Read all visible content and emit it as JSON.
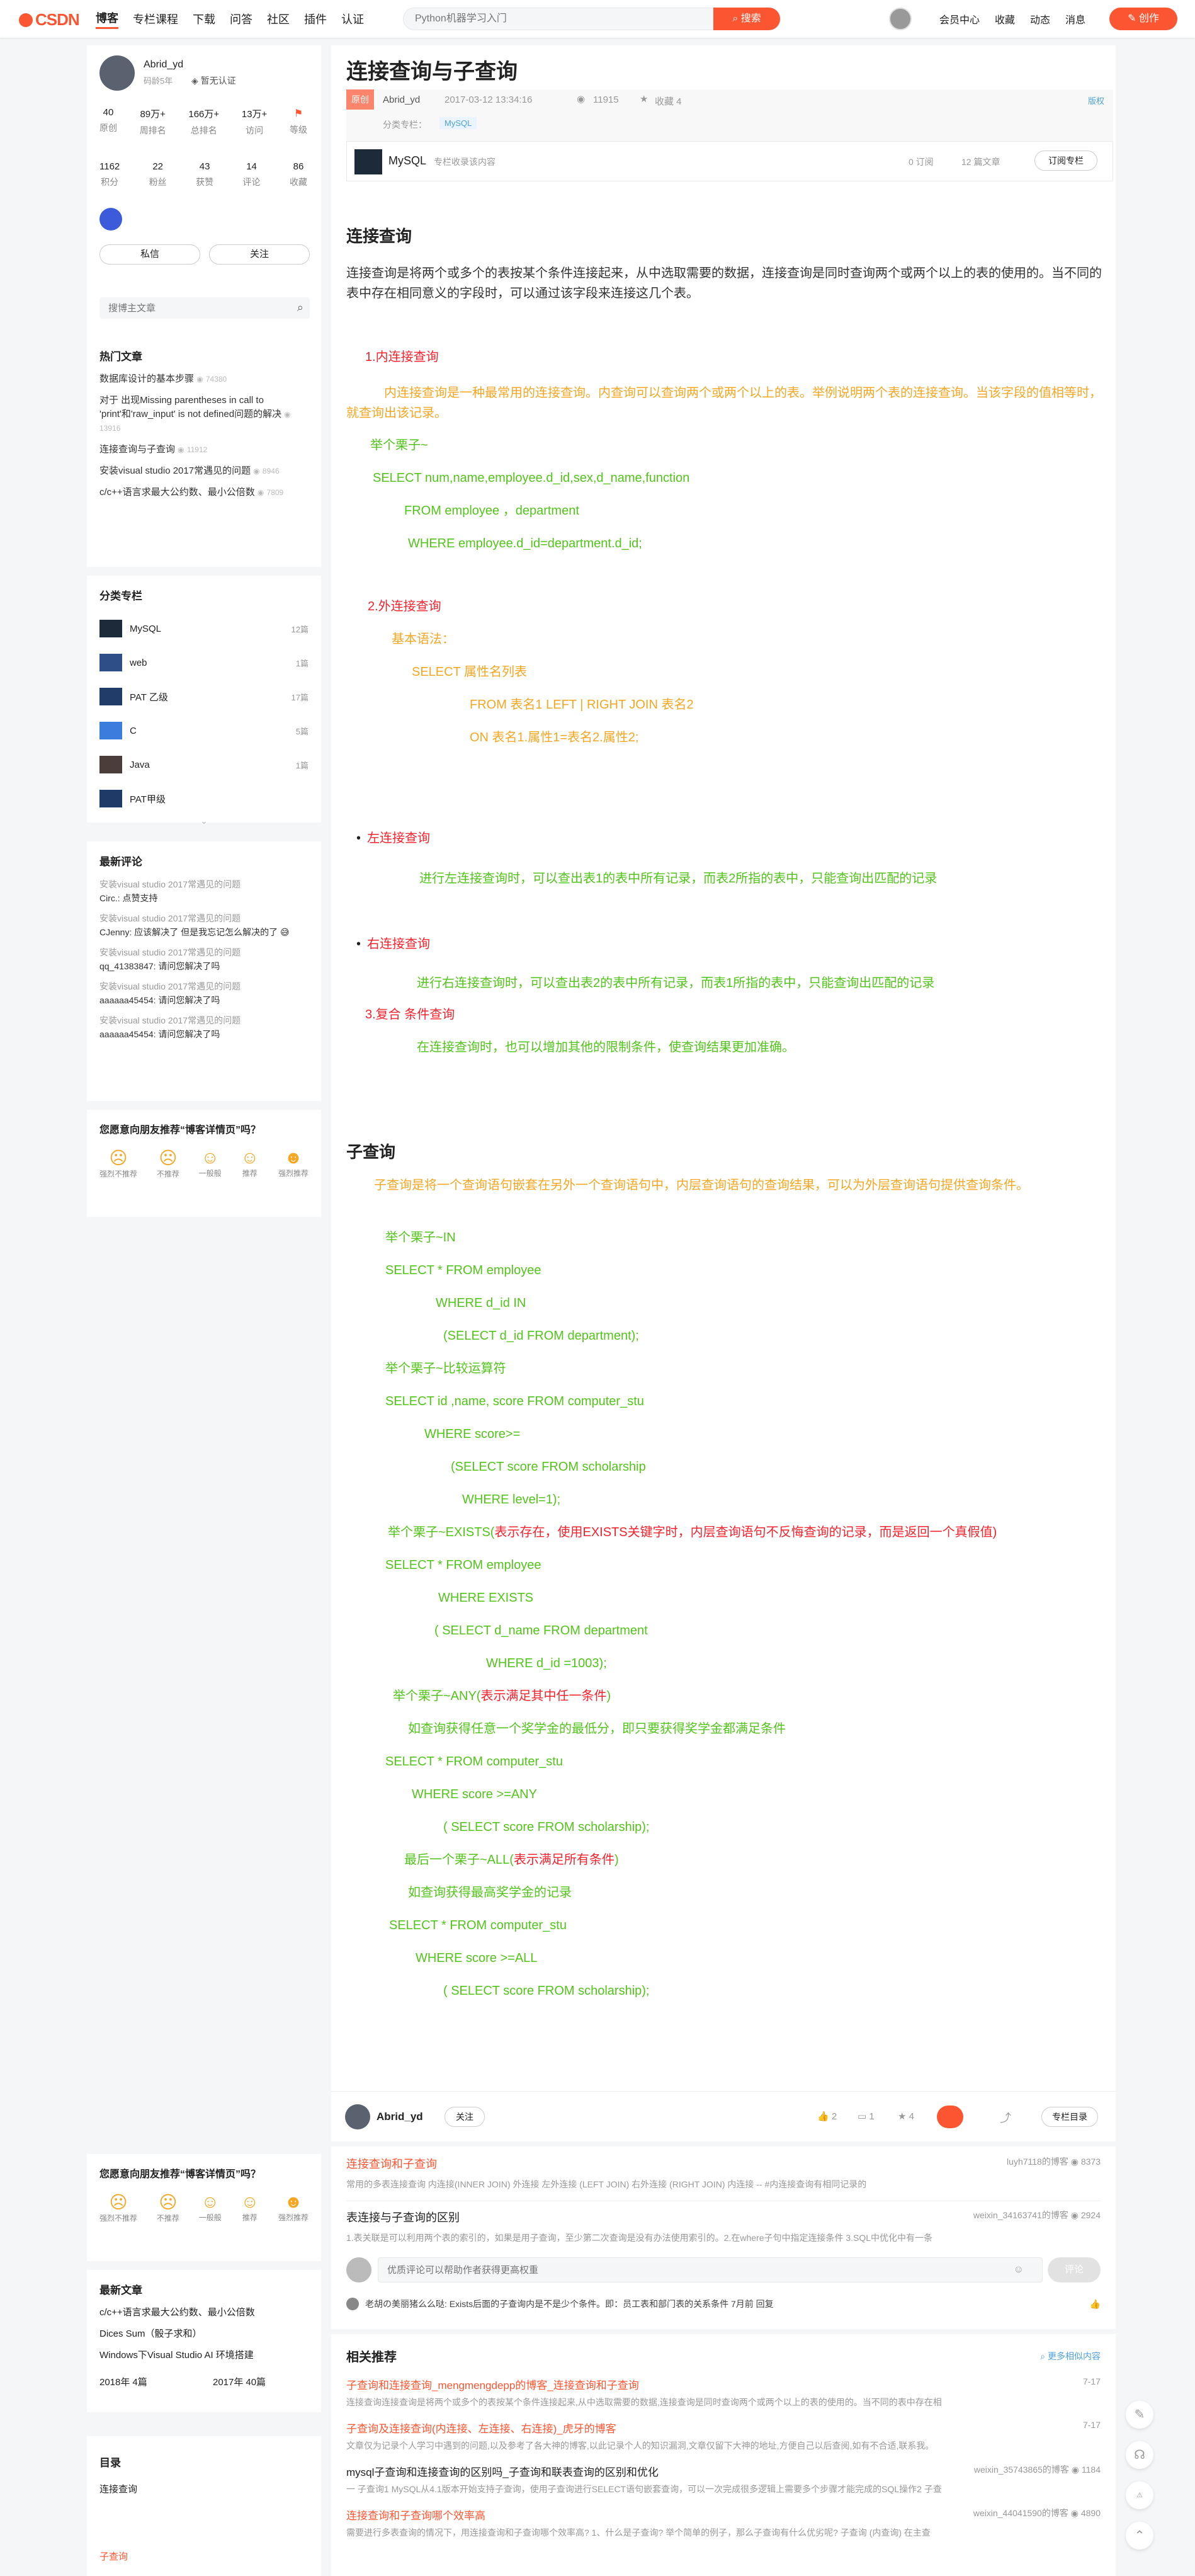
{
  "topbar": {
    "brand": "CSDN",
    "nav": [
      "博客",
      "专栏课程",
      "下载",
      "问答",
      "社区",
      "插件",
      "认证"
    ],
    "search_placeholder": "Python机器学习入门",
    "search_btn": "搜索",
    "right": [
      "会员中心",
      "收藏",
      "动态",
      "消息"
    ],
    "create": "创作"
  },
  "author": {
    "name": "Abrid_yd",
    "age": "码龄5年",
    "cert": "暂无认证",
    "stats1": [
      {
        "v": "40",
        "l": "原创"
      },
      {
        "v": "89万+",
        "l": "周排名"
      },
      {
        "v": "166万+",
        "l": "总排名"
      },
      {
        "v": "13万+",
        "l": "访问"
      },
      {
        "v": "",
        "l": "等级"
      }
    ],
    "stats2": [
      {
        "v": "1162",
        "l": "积分"
      },
      {
        "v": "22",
        "l": "粉丝"
      },
      {
        "v": "43",
        "l": "获赞"
      },
      {
        "v": "14",
        "l": "评论"
      },
      {
        "v": "86",
        "l": "收藏"
      }
    ],
    "msg_btn": "私信",
    "follow_btn": "关注",
    "search_placeholder": "搜博主文章"
  },
  "hot": {
    "title": "热门文章",
    "items": [
      {
        "t": "数据库设计的基本步骤",
        "v": "74380"
      },
      {
        "t": "对于 出现Missing parentheses in call to 'print'和'raw_input' is not defined问题的解决",
        "v": "13916"
      },
      {
        "t": "连接查询与子查询",
        "v": "11912"
      },
      {
        "t": "安装visual studio 2017常遇见的问题",
        "v": "8946"
      },
      {
        "t": "c/c++语言求最大公约数、最小公倍数",
        "v": "7809"
      }
    ]
  },
  "columns": {
    "title": "分类专栏",
    "items": [
      {
        "n": "MySQL",
        "c": "12篇"
      },
      {
        "n": "web",
        "c": "1篇"
      },
      {
        "n": "PAT 乙级",
        "c": "17篇"
      },
      {
        "n": "C",
        "c": "5篇"
      },
      {
        "n": "Java",
        "c": "1篇"
      },
      {
        "n": "PAT甲级",
        "c": ""
      }
    ]
  },
  "comments": {
    "title": "最新评论",
    "items": [
      {
        "a": "安装visual studio 2017常遇见的问题",
        "b": "Circ.: 点赞支持"
      },
      {
        "a": "安装visual studio 2017常遇见的问题",
        "b": "CJenny: 应该解决了 但是我忘记怎么解决的了 😅"
      },
      {
        "a": "安装visual studio 2017常遇见的问题",
        "b": "qq_41383847: 请问您解决了吗"
      },
      {
        "a": "安装visual studio 2017常遇见的问题",
        "b": "aaaaaa45454: 请问您解决了吗"
      },
      {
        "a": "安装visual studio 2017常遇见的问题",
        "b": "aaaaaa45454: 请问您解决了吗"
      }
    ]
  },
  "poll": {
    "title": "您愿意向朋友推荐“博客详情页”吗？",
    "opts": [
      "强烈不推荐",
      "不推荐",
      "一般般",
      "推荐",
      "强烈推荐"
    ]
  },
  "latest": {
    "title": "最新文章",
    "items": [
      "c/c++语言求最大公约数、最小公倍数",
      "Dices Sum（骰子求和）",
      "Windows下Visual Studio AI 环境搭建"
    ],
    "archive": [
      {
        "y": "2018年",
        "c": "4篇"
      },
      {
        "y": "2017年",
        "c": "40篇"
      }
    ]
  },
  "toc": {
    "title": "目录",
    "items": [
      "连接查询",
      "子查询"
    ]
  },
  "article": {
    "title": "连接查询与子查询",
    "badge": "原创",
    "author": "Abrid_yd",
    "date": "2017-03-12 13:34:16",
    "views": "11915",
    "fav": "收藏 4",
    "license": "版权",
    "cat_label": "分类专栏：",
    "cat": "MySQL",
    "col_name": "MySQL",
    "col_desc": "专栏收录该内容",
    "col_sub": "0 订阅",
    "col_count": "12 篇文章",
    "col_btn": "订阅专栏",
    "h1": "连接查询",
    "intro": "连接查询是将两个或多个的表按某个条件连接起来，从中选取需要的数据，连接查询是同时查询两个或两个以上的表的使用的。当不同的表中存在相同意义的字段时，可以通过该字段来连接这几个表。",
    "inner_h": "1.内连接查询",
    "inner_desc": "内连接查询是一种最常用的连接查询。内查询可以查询两个或两个以上的表。举例说明两个表的连接查询。当该字段的值相等时，就查询出该记录。",
    "ex1": "举个栗子~",
    "sql1": "SELECT  num,name,employee.d_id,sex,d_name,function",
    "sql2": "FROM employee ，department",
    "sql3": "WHERE employee.d_id=department.d_id;",
    "outer_h": "2.外连接查询",
    "syntax": "基本语法：",
    "s1": "SELECT 属性名列表",
    "s2": "FROM 表名1  LEFT | RIGHT JOIN 表名2",
    "s3": "ON 表名1.属性1=表名2.属性2;",
    "left_h": "左连接查询",
    "left_d": "进行左连接查询时，可以查出表1的表中所有记录，而表2所指的表中，只能查询出匹配的记录",
    "right_h": "右连接查询",
    "right_d": "进行右连接查询时，可以查出表2的表中所有记录，而表1所指的表中，只能查询出匹配的记录",
    "comp_h": "3.复合 条件查询",
    "comp_d": "在连接查询时，也可以增加其他的限制条件，使查询结果更加准确。",
    "h2": "子查询",
    "sub_desc": "子查询是将一个查询语句嵌套在另外一个查询语句中，内层查询语句的查询结果，可以为外层查询语句提供查询条件。",
    "in_ex": "举个栗子~IN",
    "in1": "SELECT  *   FROM   employee",
    "in2": "WHERE  d_id   IN",
    "in3": "(SELECT   d_id    FROM    department);",
    "cmp_ex": "举个栗子~比较运算符",
    "c1": "SELECT  id ,name, score FROM computer_stu",
    "c2": "WHERE  score>=",
    "c3": "(SELECT score FROM scholarship",
    "c4": "WHERE level=1);",
    "ex_ex": "举个栗子~EXISTS(",
    "ex_red": "表示存在，使用EXISTS关键字时，内层查询语句不反悔查询的记录，而是返回一个真假值)",
    "e1": "SELECT  *   FROM employee",
    "e2": "WHERE EXISTS",
    "e3": "( SELECT d_name FROM department",
    "e4": "WHERE d_id =1003);",
    "any_ex": "举个栗子~ANY(",
    "any_red": "表示满足其中任一条件",
    "any_end": ")",
    "any_d": "如查询获得任意一个奖学金的最低分，即只要获得奖学金都满足条件",
    "a1": "SELECT * FROM computer_stu",
    "a2": "WHERE score >=ANY",
    "a3": "( SELECT score FROM scholarship);",
    "all_ex": "最后一个栗子~ALL(",
    "all_red": "表示满足所有条件",
    "all_end": ")",
    "all_d": "如查询获得最高奖学金的记录",
    "l1": "SELECT * FROM computer_stu",
    "l2": "WHERE score >=ALL",
    "l3": "( SELECT score FROM scholarship);"
  },
  "bottom": {
    "author": "Abrid_yd",
    "follow": "关注",
    "likes": "2",
    "comments": "1",
    "favs": "4",
    "col_dir": "专栏目录"
  },
  "rec_top": [
    {
      "t": "连接查询和子查询",
      "by": "luyh7118的博客",
      "v": "8373",
      "d": "常用的多表连接查询  内连接(INNER JOIN) 外连接 左外连接 (LEFT JOIN) 右外连接 (RIGHT JOIN) 内连接 -- #内连接查询有相同记录的"
    },
    {
      "t": "表连接与子查询的区别",
      "by": "weixin_34163741的博客",
      "v": "2924",
      "d": "1.表关联是可以利用两个表的索引的，如果是用子查询，至少第二次查询是没有办法使用索引的。2.在where子句中指定连接条件 3.SQL中优化中有一条"
    }
  ],
  "comment_box": {
    "placeholder": "优质评论可以帮助作者获得更高权重",
    "btn": "评论",
    "first": "老胡の美丽猪么么哒: Exists后面的子查询内是不是少个条件。即：员工表和部门表的关系条件  7月前  回复"
  },
  "related": {
    "title": "相关推荐",
    "more": "更多相似内容",
    "items": [
      {
        "t": "子查询和连接查询_mengmengdepp的博客_连接查询和子查询",
        "date": "7-17",
        "d": "连接查询连接查询是将两个或多个的表按某个条件连接起来,从中选取需要的数据,连接查询是同时查询两个或两个以上的表的使用的。当不同的表中存在相"
      },
      {
        "t": "子查询及连接查询(内连接、左连接、右连接)_虎牙的博客",
        "date": "7-17",
        "d": "文章仅为记录个人学习中遇到的问题,以及参考了各大神的博客,以此记录个人的知识漏洞,文章仅留下大神的地址,方便自己以后查阅,如有不合适,联系我。"
      },
      {
        "t": "mysql子查询和连接查询的区别吗_子查询和联表查询的区别和优化",
        "by": "weixin_35743865的博客",
        "v": "1184",
        "d": "一 子查询1 MySQL从4.1版本开始支持子查询，使用子查询进行SELECT语句嵌套查询，可以一次完成很多逻辑上需要多个步骤才能完成的SQL操作2 子查"
      },
      {
        "t": "连接查询和子查询哪个效率高",
        "by": "weixin_44041590的博客",
        "v": "4890",
        "d": "需要进行多表查询的情况下，用连接查询和子查询哪个效率高? 1、什么是子查询? 举个简单的例子，那么子查询有什么优劣呢? 子查询 (内查询) 在主查"
      }
    ]
  }
}
